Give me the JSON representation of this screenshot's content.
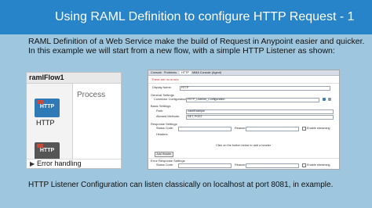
{
  "slide": {
    "title": "Using RAML Definition to configure HTTP Request - 1",
    "intro_line1": "RAML Definition of a Web Service make the build of Request in Anypoint easier and quicker.",
    "intro_line2": "In this example we will start from a new flow, with a simple HTTP Listener as shown:",
    "footer": "HTTP Listener Configuration can listen classically on localhost at port 8081, in example."
  },
  "flow": {
    "name": "ramlFlow1",
    "process_label": "Process",
    "source_label": "HTTP",
    "tile_text": "HTTP",
    "error_label": "Error handling"
  },
  "props": {
    "tabs": [
      "Console",
      "Problems",
      "HTTP",
      "MMA Console (Agent)"
    ],
    "active_tab": "HTTP",
    "notice": "There are no errors",
    "display_name_label": "Display Name:",
    "display_name_value": "HTTP",
    "general_settings": "General Settings",
    "connector_config_label": "Connector Configuration:",
    "connector_config_value": "HTTP_Listener_Configuration",
    "basic_settings": "Basic Settings",
    "path_label": "Path:",
    "path_value": "/ramlExample",
    "allowed_methods_label": "Allowed Methods:",
    "allowed_methods_value": "GET, POST",
    "response_settings": "Response Settings",
    "status_code_label": "Status Code:",
    "reason_label": "Reason:",
    "headers_label": "Headers:",
    "enable_streaming": "Enable streaming",
    "click_hint": "Click on the button below to add a header",
    "add_header_button": "Add Header",
    "error_response_settings": "Error Response Settings",
    "status_code_label_2": "Status Code:",
    "reason_label_2": "Reason:",
    "enable_streaming_2": "Enable streaming"
  },
  "colors": {
    "banner": "#2784c9",
    "background": "#9ec6de",
    "http_tile": "#2f79b7"
  }
}
